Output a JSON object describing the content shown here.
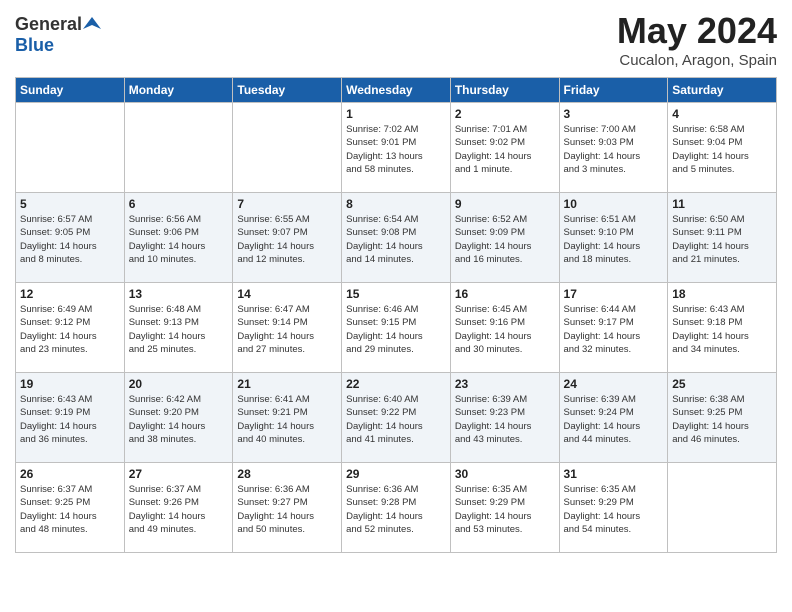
{
  "header": {
    "logo_general": "General",
    "logo_blue": "Blue",
    "month": "May 2024",
    "location": "Cucalon, Aragon, Spain"
  },
  "weekdays": [
    "Sunday",
    "Monday",
    "Tuesday",
    "Wednesday",
    "Thursday",
    "Friday",
    "Saturday"
  ],
  "weeks": [
    [
      {
        "day": "",
        "info": ""
      },
      {
        "day": "",
        "info": ""
      },
      {
        "day": "",
        "info": ""
      },
      {
        "day": "1",
        "info": "Sunrise: 7:02 AM\nSunset: 9:01 PM\nDaylight: 13 hours\nand 58 minutes."
      },
      {
        "day": "2",
        "info": "Sunrise: 7:01 AM\nSunset: 9:02 PM\nDaylight: 14 hours\nand 1 minute."
      },
      {
        "day": "3",
        "info": "Sunrise: 7:00 AM\nSunset: 9:03 PM\nDaylight: 14 hours\nand 3 minutes."
      },
      {
        "day": "4",
        "info": "Sunrise: 6:58 AM\nSunset: 9:04 PM\nDaylight: 14 hours\nand 5 minutes."
      }
    ],
    [
      {
        "day": "5",
        "info": "Sunrise: 6:57 AM\nSunset: 9:05 PM\nDaylight: 14 hours\nand 8 minutes."
      },
      {
        "day": "6",
        "info": "Sunrise: 6:56 AM\nSunset: 9:06 PM\nDaylight: 14 hours\nand 10 minutes."
      },
      {
        "day": "7",
        "info": "Sunrise: 6:55 AM\nSunset: 9:07 PM\nDaylight: 14 hours\nand 12 minutes."
      },
      {
        "day": "8",
        "info": "Sunrise: 6:54 AM\nSunset: 9:08 PM\nDaylight: 14 hours\nand 14 minutes."
      },
      {
        "day": "9",
        "info": "Sunrise: 6:52 AM\nSunset: 9:09 PM\nDaylight: 14 hours\nand 16 minutes."
      },
      {
        "day": "10",
        "info": "Sunrise: 6:51 AM\nSunset: 9:10 PM\nDaylight: 14 hours\nand 18 minutes."
      },
      {
        "day": "11",
        "info": "Sunrise: 6:50 AM\nSunset: 9:11 PM\nDaylight: 14 hours\nand 21 minutes."
      }
    ],
    [
      {
        "day": "12",
        "info": "Sunrise: 6:49 AM\nSunset: 9:12 PM\nDaylight: 14 hours\nand 23 minutes."
      },
      {
        "day": "13",
        "info": "Sunrise: 6:48 AM\nSunset: 9:13 PM\nDaylight: 14 hours\nand 25 minutes."
      },
      {
        "day": "14",
        "info": "Sunrise: 6:47 AM\nSunset: 9:14 PM\nDaylight: 14 hours\nand 27 minutes."
      },
      {
        "day": "15",
        "info": "Sunrise: 6:46 AM\nSunset: 9:15 PM\nDaylight: 14 hours\nand 29 minutes."
      },
      {
        "day": "16",
        "info": "Sunrise: 6:45 AM\nSunset: 9:16 PM\nDaylight: 14 hours\nand 30 minutes."
      },
      {
        "day": "17",
        "info": "Sunrise: 6:44 AM\nSunset: 9:17 PM\nDaylight: 14 hours\nand 32 minutes."
      },
      {
        "day": "18",
        "info": "Sunrise: 6:43 AM\nSunset: 9:18 PM\nDaylight: 14 hours\nand 34 minutes."
      }
    ],
    [
      {
        "day": "19",
        "info": "Sunrise: 6:43 AM\nSunset: 9:19 PM\nDaylight: 14 hours\nand 36 minutes."
      },
      {
        "day": "20",
        "info": "Sunrise: 6:42 AM\nSunset: 9:20 PM\nDaylight: 14 hours\nand 38 minutes."
      },
      {
        "day": "21",
        "info": "Sunrise: 6:41 AM\nSunset: 9:21 PM\nDaylight: 14 hours\nand 40 minutes."
      },
      {
        "day": "22",
        "info": "Sunrise: 6:40 AM\nSunset: 9:22 PM\nDaylight: 14 hours\nand 41 minutes."
      },
      {
        "day": "23",
        "info": "Sunrise: 6:39 AM\nSunset: 9:23 PM\nDaylight: 14 hours\nand 43 minutes."
      },
      {
        "day": "24",
        "info": "Sunrise: 6:39 AM\nSunset: 9:24 PM\nDaylight: 14 hours\nand 44 minutes."
      },
      {
        "day": "25",
        "info": "Sunrise: 6:38 AM\nSunset: 9:25 PM\nDaylight: 14 hours\nand 46 minutes."
      }
    ],
    [
      {
        "day": "26",
        "info": "Sunrise: 6:37 AM\nSunset: 9:25 PM\nDaylight: 14 hours\nand 48 minutes."
      },
      {
        "day": "27",
        "info": "Sunrise: 6:37 AM\nSunset: 9:26 PM\nDaylight: 14 hours\nand 49 minutes."
      },
      {
        "day": "28",
        "info": "Sunrise: 6:36 AM\nSunset: 9:27 PM\nDaylight: 14 hours\nand 50 minutes."
      },
      {
        "day": "29",
        "info": "Sunrise: 6:36 AM\nSunset: 9:28 PM\nDaylight: 14 hours\nand 52 minutes."
      },
      {
        "day": "30",
        "info": "Sunrise: 6:35 AM\nSunset: 9:29 PM\nDaylight: 14 hours\nand 53 minutes."
      },
      {
        "day": "31",
        "info": "Sunrise: 6:35 AM\nSunset: 9:29 PM\nDaylight: 14 hours\nand 54 minutes."
      },
      {
        "day": "",
        "info": ""
      }
    ]
  ]
}
